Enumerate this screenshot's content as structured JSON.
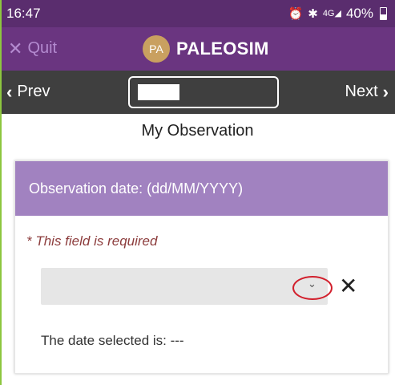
{
  "status_bar": {
    "time": "16:47",
    "alarm_icon": "alarm-clock-icon",
    "bluetooth_icon": "bluetooth-icon",
    "signal_label": "4G",
    "signal_icon": "signal-icon",
    "battery_percent": "40%",
    "battery_level": 0.4
  },
  "app_bar": {
    "quit_label": "Quit",
    "logo_text": "PA",
    "app_name": "PALEOSIM"
  },
  "nav": {
    "prev_label": "Prev",
    "next_label": "Next"
  },
  "page": {
    "title": "My Observation"
  },
  "form": {
    "field_label": "Observation date: (dd/MM/YYYY)",
    "required_message": "* This field is required",
    "date_value": "",
    "date_selected_text": "The date selected is: ---"
  },
  "colors": {
    "status_bar": "#5a2d6e",
    "app_bar": "#6a3580",
    "nav_bar": "#3f3f3f",
    "card_header": "#a182c0",
    "required_text": "#8c3c3c",
    "highlight_circle": "#d21f2c",
    "logo": "#c9a060",
    "quit_text": "#b48bd0"
  }
}
